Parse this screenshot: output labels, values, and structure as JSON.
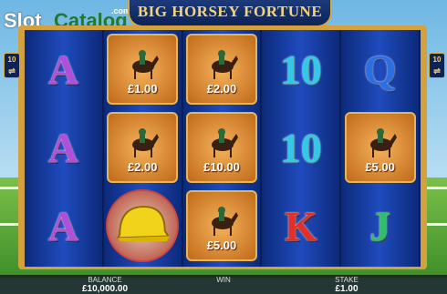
{
  "logo": {
    "part1": "Slot",
    "part2": "Catalog",
    "suffix": ".com"
  },
  "game_title": "BIG HORSEY FORTUNE",
  "side_badges": {
    "left": "10",
    "right": "10"
  },
  "reels": [
    {
      "symbols": [
        {
          "type": "letter",
          "text": "A",
          "color": "purple"
        },
        {
          "type": "letter",
          "text": "A",
          "color": "purple"
        },
        {
          "type": "letter",
          "text": "A",
          "color": "purple"
        }
      ]
    },
    {
      "symbols": [
        {
          "type": "prize",
          "value": "£1.00"
        },
        {
          "type": "prize",
          "value": "£2.00"
        },
        {
          "type": "helmet"
        }
      ]
    },
    {
      "symbols": [
        {
          "type": "prize",
          "value": "£2.00"
        },
        {
          "type": "prize",
          "value": "£10.00"
        },
        {
          "type": "prize",
          "value": "£5.00"
        }
      ]
    },
    {
      "symbols": [
        {
          "type": "letter",
          "text": "10",
          "color": "cyan"
        },
        {
          "type": "letter",
          "text": "10",
          "color": "cyan"
        },
        {
          "type": "letter",
          "text": "K",
          "color": "red"
        }
      ]
    },
    {
      "symbols": [
        {
          "type": "letter",
          "text": "Q",
          "color": "blue"
        },
        {
          "type": "prize",
          "value": "£5.00"
        },
        {
          "type": "letter",
          "text": "J",
          "color": "green"
        }
      ]
    }
  ],
  "bottom_bar": {
    "balance_label": "BALANCE",
    "balance_value": "£10,000.00",
    "win_label": "WIN",
    "win_value": "",
    "stake_label": "STAKE",
    "stake_value": "£1.00"
  }
}
